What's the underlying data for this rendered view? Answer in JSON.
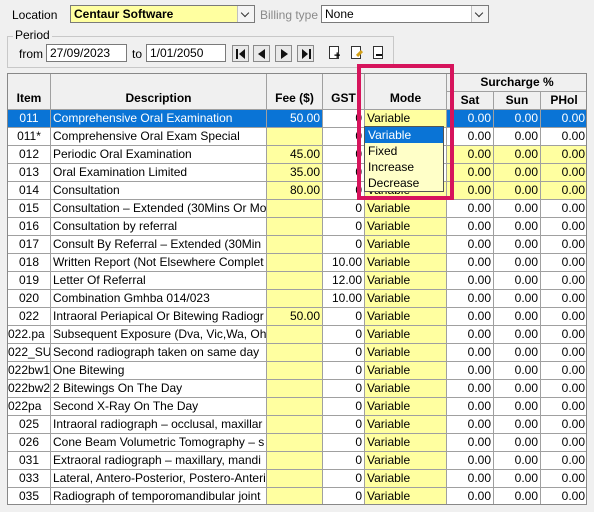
{
  "filters": {
    "location_label": "Location",
    "location_value": "Centaur Software",
    "billing_type_label": "Billing type",
    "billing_type_value": "None",
    "period_label": "Period",
    "from_label": "from",
    "from_value": "27/09/2023",
    "to_label": "to",
    "to_value": "1/01/2050"
  },
  "columns": {
    "item": "Item",
    "description": "Description",
    "fee": "Fee ($)",
    "gst": "GST",
    "mode": "Mode",
    "surcharge": "Surcharge %",
    "sat": "Sat",
    "sun": "Sun",
    "phol": "PHol"
  },
  "rows": [
    {
      "item": "011",
      "desc": "Comprehensive Oral Examination",
      "fee": "50.00",
      "gst": "0",
      "mode": "Variable",
      "sat": "0.00",
      "sun": "0.00",
      "phol": "0.00"
    },
    {
      "item": "011*",
      "desc": "Comprehensive Oral Exam Special",
      "fee": "",
      "gst": "0",
      "mode": "",
      "sat": "0.00",
      "sun": "0.00",
      "phol": "0.00"
    },
    {
      "item": "012",
      "desc": "Periodic Oral Examination",
      "fee": "45.00",
      "gst": "0",
      "mode": "",
      "sat": "0.00",
      "sun": "0.00",
      "phol": "0.00"
    },
    {
      "item": "013",
      "desc": "Oral Examination Limited",
      "fee": "35.00",
      "gst": "0",
      "mode": "",
      "sat": "0.00",
      "sun": "0.00",
      "phol": "0.00"
    },
    {
      "item": "014",
      "desc": "Consultation",
      "fee": "80.00",
      "gst": "0",
      "mode": "Variable",
      "sat": "0.00",
      "sun": "0.00",
      "phol": "0.00"
    },
    {
      "item": "015",
      "desc": "Consultation – Extended (30Mins Or Mo",
      "fee": "",
      "gst": "0",
      "mode": "Variable",
      "sat": "0.00",
      "sun": "0.00",
      "phol": "0.00"
    },
    {
      "item": "016",
      "desc": "Consultation by referral",
      "fee": "",
      "gst": "0",
      "mode": "Variable",
      "sat": "0.00",
      "sun": "0.00",
      "phol": "0.00"
    },
    {
      "item": "017",
      "desc": "Consult By Referral – Extended  (30Min",
      "fee": "",
      "gst": "0",
      "mode": "Variable",
      "sat": "0.00",
      "sun": "0.00",
      "phol": "0.00"
    },
    {
      "item": "018",
      "desc": "Written Report (Not Elsewhere Complet",
      "fee": "",
      "gst": "10.00",
      "mode": "Variable",
      "sat": "0.00",
      "sun": "0.00",
      "phol": "0.00"
    },
    {
      "item": "019",
      "desc": "Letter Of Referral",
      "fee": "",
      "gst": "12.00",
      "mode": "Variable",
      "sat": "0.00",
      "sun": "0.00",
      "phol": "0.00"
    },
    {
      "item": "020",
      "desc": "Combination Gmhba 014/023",
      "fee": "",
      "gst": "10.00",
      "mode": "Variable",
      "sat": "0.00",
      "sun": "0.00",
      "phol": "0.00"
    },
    {
      "item": "022",
      "desc": "Intraoral Periapical Or Bitewing Radiogr",
      "fee": "50.00",
      "gst": "0",
      "mode": "Variable",
      "sat": "0.00",
      "sun": "0.00",
      "phol": "0.00"
    },
    {
      "item": "022.pa",
      "desc": "Subsequent Exposure (Dva, Vic,Wa, Oh",
      "fee": "",
      "gst": "0",
      "mode": "Variable",
      "sat": "0.00",
      "sun": "0.00",
      "phol": "0.00"
    },
    {
      "item": "022_SU",
      "desc": "Second radiograph taken on same day",
      "fee": "",
      "gst": "0",
      "mode": "Variable",
      "sat": "0.00",
      "sun": "0.00",
      "phol": "0.00"
    },
    {
      "item": "022bw1",
      "desc": "One Bitewing",
      "fee": "",
      "gst": "0",
      "mode": "Variable",
      "sat": "0.00",
      "sun": "0.00",
      "phol": "0.00"
    },
    {
      "item": "022bw2",
      "desc": "2 Bitewings On The Day",
      "fee": "",
      "gst": "0",
      "mode": "Variable",
      "sat": "0.00",
      "sun": "0.00",
      "phol": "0.00"
    },
    {
      "item": "022pa",
      "desc": "Second X-Ray On The Day",
      "fee": "",
      "gst": "0",
      "mode": "Variable",
      "sat": "0.00",
      "sun": "0.00",
      "phol": "0.00"
    },
    {
      "item": "025",
      "desc": "Intraoral radiograph – occlusal, maxillar",
      "fee": "",
      "gst": "0",
      "mode": "Variable",
      "sat": "0.00",
      "sun": "0.00",
      "phol": "0.00"
    },
    {
      "item": "026",
      "desc": "Cone Beam Volumetric Tomography – s",
      "fee": "",
      "gst": "0",
      "mode": "Variable",
      "sat": "0.00",
      "sun": "0.00",
      "phol": "0.00"
    },
    {
      "item": "031",
      "desc": " Extraoral radiograph – maxillary, mandi",
      "fee": "",
      "gst": "0",
      "mode": "Variable",
      "sat": "0.00",
      "sun": "0.00",
      "phol": "0.00"
    },
    {
      "item": "033",
      "desc": "Lateral, Antero-Posterior, Postero-Anteri",
      "fee": "",
      "gst": "0",
      "mode": "Variable",
      "sat": "0.00",
      "sun": "0.00",
      "phol": "0.00"
    },
    {
      "item": "035",
      "desc": "Radiograph of temporomandibular joint",
      "fee": "",
      "gst": "0",
      "mode": "Variable",
      "sat": "0.00",
      "sun": "0.00",
      "phol": "0.00"
    }
  ],
  "mode_dropdown": {
    "options": [
      "Variable",
      "Fixed",
      "Increase",
      "Decrease"
    ],
    "selected": "Variable"
  },
  "colors": {
    "selection": "#0a74d6",
    "editable": "#ffffa0",
    "highlight": "#d6145c"
  }
}
